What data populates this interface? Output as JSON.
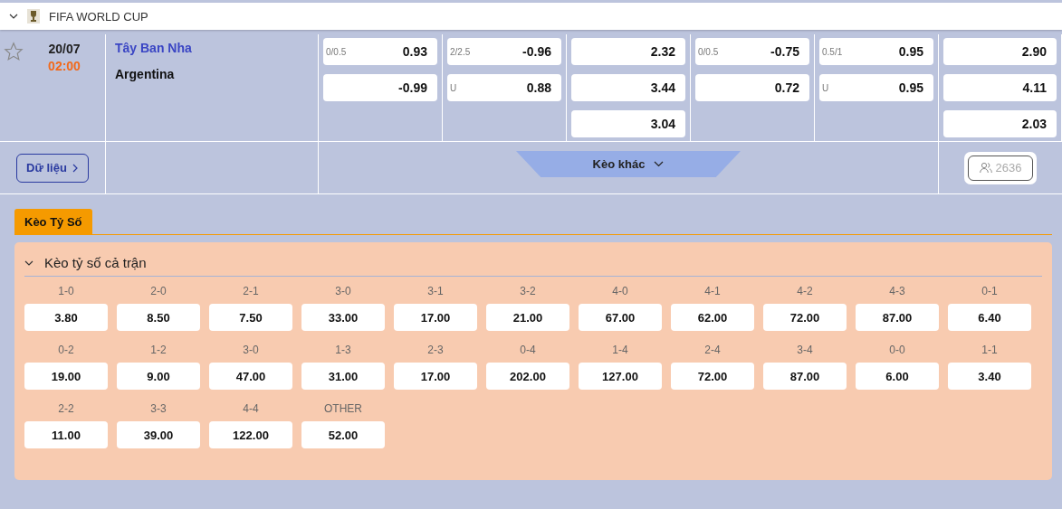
{
  "league": {
    "title": "FIFA WORLD CUP",
    "expanded": true
  },
  "match": {
    "favorite": false,
    "date": "20/07",
    "time": "02:00",
    "home": "Tây Ban Nha",
    "away": "Argentina",
    "markets": [
      [
        {
          "line": "0/0.5",
          "odds": "0.93"
        },
        {
          "odds": "-0.99"
        }
      ],
      [
        {
          "line": "2/2.5",
          "odds": "-0.96"
        },
        {
          "line": "U",
          "odds": "0.88"
        }
      ],
      [
        {
          "odds": "2.32"
        },
        {
          "odds": "3.44"
        },
        {
          "odds": "3.04"
        }
      ],
      [
        {
          "line": "0/0.5",
          "odds": "-0.75"
        },
        {
          "odds": "0.72"
        }
      ],
      [
        {
          "line": "0.5/1",
          "odds": "0.95"
        },
        {
          "line": "U",
          "odds": "0.95"
        }
      ],
      [
        {
          "odds": "2.90"
        },
        {
          "odds": "4.11"
        },
        {
          "odds": "2.03"
        }
      ]
    ],
    "data_button": "Dữ liệu",
    "more_button": "Kèo khác",
    "viewers": "2636"
  },
  "tabs": [
    {
      "label": "Kèo Tỷ Số",
      "selected": true
    }
  ],
  "section": {
    "title": "Kèo tỷ số cả trận",
    "expanded": true,
    "scores": [
      {
        "score": "1-0",
        "odds": "3.80"
      },
      {
        "score": "2-0",
        "odds": "8.50"
      },
      {
        "score": "2-1",
        "odds": "7.50"
      },
      {
        "score": "3-0",
        "odds": "33.00"
      },
      {
        "score": "3-1",
        "odds": "17.00"
      },
      {
        "score": "3-2",
        "odds": "21.00"
      },
      {
        "score": "4-0",
        "odds": "67.00"
      },
      {
        "score": "4-1",
        "odds": "62.00"
      },
      {
        "score": "4-2",
        "odds": "72.00"
      },
      {
        "score": "4-3",
        "odds": "87.00"
      },
      {
        "score": "0-1",
        "odds": "6.40"
      },
      {
        "score": "0-2",
        "odds": "19.00"
      },
      {
        "score": "1-2",
        "odds": "9.00"
      },
      {
        "score": "3-0",
        "odds": "47.00"
      },
      {
        "score": "1-3",
        "odds": "31.00"
      },
      {
        "score": "2-3",
        "odds": "17.00"
      },
      {
        "score": "0-4",
        "odds": "202.00"
      },
      {
        "score": "1-4",
        "odds": "127.00"
      },
      {
        "score": "2-4",
        "odds": "72.00"
      },
      {
        "score": "3-4",
        "odds": "87.00"
      },
      {
        "score": "0-0",
        "odds": "6.00"
      },
      {
        "score": "1-1",
        "odds": "3.40"
      },
      {
        "score": "2-2",
        "odds": "11.00"
      },
      {
        "score": "3-3",
        "odds": "39.00"
      },
      {
        "score": "4-4",
        "odds": "122.00"
      },
      {
        "score": "OTHER",
        "odds": "52.00"
      }
    ]
  }
}
